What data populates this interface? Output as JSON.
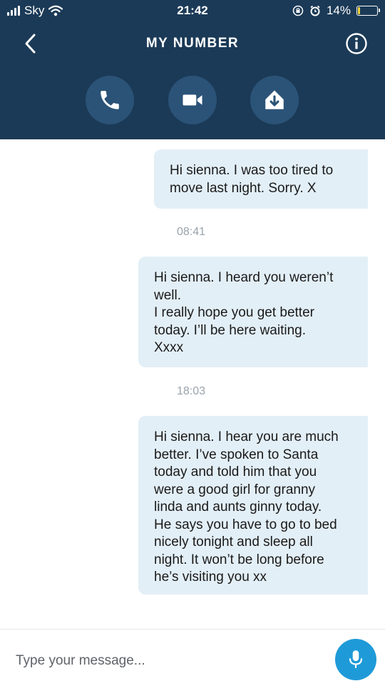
{
  "status_bar": {
    "carrier": "Sky",
    "time": "21:42",
    "battery_percent": "14%",
    "battery_level": 0.14
  },
  "header": {
    "title": "MY NUMBER",
    "actions": [
      {
        "icon": "phone-icon"
      },
      {
        "icon": "video-camera-icon"
      },
      {
        "icon": "download-icon"
      }
    ]
  },
  "conversation": {
    "messages": [
      {
        "text": "Hi sienna. I was too tired to\nmove last night. Sorry. X"
      },
      {
        "text": "Hi sienna. I heard you weren’t\nwell.\nI really hope you get better\ntoday. I’ll be here waiting.\nXxxx"
      },
      {
        "text": "Hi sienna. I hear you are much\nbetter. I’ve spoken to Santa\ntoday and told him that you\nwere a good girl for granny\nlinda and aunts ginny today.\nHe says you have to go to bed\nnicely tonight and sleep all\nnight. It won’t be long before\nhe’s visiting you xx"
      }
    ],
    "timestamps": [
      "08:41",
      "18:03"
    ]
  },
  "composer": {
    "placeholder": "Type your message..."
  },
  "colors": {
    "header_bg": "#1b3a57",
    "action_button_bg": "#2b5377",
    "bubble_bg": "#e3eff7",
    "mic_button_bg": "#1f9ad8"
  }
}
